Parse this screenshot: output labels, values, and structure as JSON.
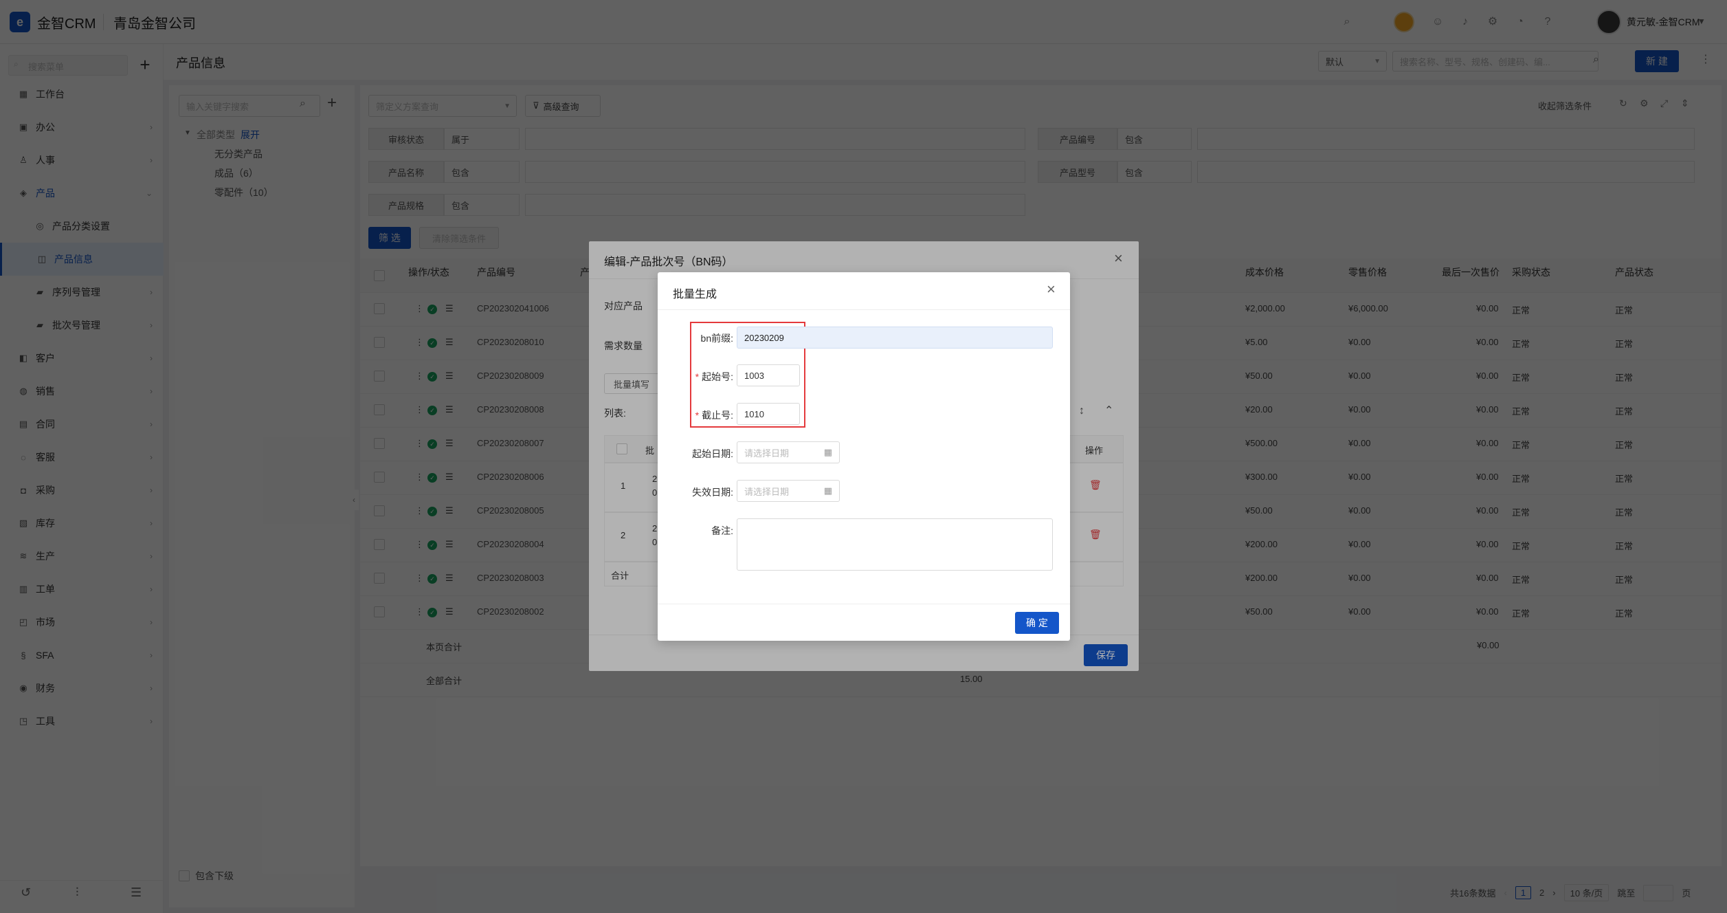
{
  "topbar": {
    "logo_letter": "e",
    "app_name": "金智CRM",
    "company": "青岛金智公司",
    "user_name": "黄元敏-金智CRM",
    "icons": [
      "search-icon",
      "orange-badge-icon",
      "contacts-icon",
      "bell-icon",
      "gear-icon",
      "pie-chart-icon",
      "help-icon"
    ]
  },
  "sidebar": {
    "search_placeholder": "搜索菜单",
    "items": [
      {
        "label": "工作台",
        "icon": "dashboard-icon",
        "has_arrow": false
      },
      {
        "label": "办公",
        "icon": "office-icon",
        "has_arrow": true
      },
      {
        "label": "人事",
        "icon": "people-icon",
        "has_arrow": true
      },
      {
        "label": "产品",
        "icon": "product-icon",
        "has_arrow": true,
        "expanded": true
      },
      {
        "label": "产品分类设置",
        "sub": true,
        "icon": "category-icon"
      },
      {
        "label": "产品信息",
        "sub": true,
        "active": true,
        "icon": "info-icon"
      },
      {
        "label": "序列号管理",
        "sub": true,
        "icon": "folder-icon",
        "has_arrow": true
      },
      {
        "label": "批次号管理",
        "sub": true,
        "icon": "folder-icon",
        "has_arrow": true
      },
      {
        "label": "客户",
        "icon": "customer-icon",
        "has_arrow": true
      },
      {
        "label": "销售",
        "icon": "sales-icon",
        "has_arrow": true
      },
      {
        "label": "合同",
        "icon": "contract-icon",
        "has_arrow": true
      },
      {
        "label": "客服",
        "icon": "service-icon",
        "has_arrow": true
      },
      {
        "label": "采购",
        "icon": "purchase-icon",
        "has_arrow": true
      },
      {
        "label": "库存",
        "icon": "inventory-icon",
        "has_arrow": true
      },
      {
        "label": "生产",
        "icon": "production-icon",
        "has_arrow": true
      },
      {
        "label": "工单",
        "icon": "ticket-icon",
        "has_arrow": true
      },
      {
        "label": "市场",
        "icon": "market-icon",
        "has_arrow": true
      },
      {
        "label": "SFA",
        "icon": "sfa-icon",
        "has_arrow": true
      },
      {
        "label": "财务",
        "icon": "finance-icon",
        "has_arrow": true
      },
      {
        "label": "工具",
        "icon": "tools-icon",
        "has_arrow": true
      }
    ]
  },
  "main": {
    "title": "产品信息",
    "view_select": "默认",
    "search_placeholder": "搜索名称、型号、规格、创建码、编...",
    "new_button": "新 建",
    "tree_search_placeholder": "输入关键字搜索",
    "tree": {
      "root": "全部类型",
      "expand": "展开",
      "children": [
        "无分类产品",
        "成品（6）",
        "零配件（10）"
      ],
      "include_sub": "包含下级"
    },
    "filter_scheme_placeholder": "筛定义方案查询",
    "advanced_query": "高级查询",
    "collapse_filter": "收起筛选条件",
    "filters": [
      {
        "label": "审核状态",
        "op": "属于"
      },
      {
        "label": "产品编号",
        "op": "包含"
      },
      {
        "label": "产品名称",
        "op": "包含"
      },
      {
        "label": "产品型号",
        "op": "包含"
      },
      {
        "label": "产品规格",
        "op": "包含"
      }
    ],
    "filter_button": "筛 选",
    "clear_button": "清除筛选条件",
    "columns": [
      "操作/状态",
      "产品编号",
      "产",
      "成本价格",
      "零售价格",
      "最后一次售价",
      "采购状态",
      "产品状态"
    ],
    "rows": [
      {
        "code": "CP202302041006",
        "cost": "¥2,000.00",
        "retail": "¥6,000.00",
        "last": "¥0.00",
        "purchase": "正常",
        "status": "正常"
      },
      {
        "code": "CP20230208010",
        "cost": "¥5.00",
        "retail": "¥0.00",
        "last": "¥0.00",
        "purchase": "正常",
        "status": "正常"
      },
      {
        "code": "CP20230208009",
        "cost": "¥50.00",
        "retail": "¥0.00",
        "last": "¥0.00",
        "purchase": "正常",
        "status": "正常"
      },
      {
        "code": "CP20230208008",
        "cost": "¥20.00",
        "retail": "¥0.00",
        "last": "¥0.00",
        "purchase": "正常",
        "status": "正常"
      },
      {
        "code": "CP20230208007",
        "cost": "¥500.00",
        "retail": "¥0.00",
        "last": "¥0.00",
        "purchase": "正常",
        "status": "正常"
      },
      {
        "code": "CP20230208006",
        "cost": "¥300.00",
        "retail": "¥0.00",
        "last": "¥0.00",
        "purchase": "正常",
        "status": "正常"
      },
      {
        "code": "CP20230208005",
        "cost": "¥50.00",
        "retail": "¥0.00",
        "last": "¥0.00",
        "purchase": "正常",
        "status": "正常"
      },
      {
        "code": "CP20230208004",
        "cost": "¥200.00",
        "retail": "¥0.00",
        "last": "¥0.00",
        "purchase": "正常",
        "status": "正常"
      },
      {
        "code": "CP20230208003",
        "cost": "¥200.00",
        "retail": "¥0.00",
        "last": "¥0.00",
        "purchase": "正常",
        "status": "正常"
      },
      {
        "code": "CP20230208002",
        "cost": "¥50.00",
        "retail": "¥0.00",
        "last": "¥0.00",
        "purchase": "正常",
        "status": "正常"
      }
    ],
    "page_total_label": "本页合计",
    "page_total_last": "¥0.00",
    "all_total_label": "全部合计",
    "all_total_value": "15.00",
    "pagination": {
      "total": "共16条数据",
      "pages": [
        "1",
        "2"
      ],
      "page_size": "10 条/页",
      "goto": "跳至",
      "page_unit": "页"
    }
  },
  "dialog_bn": {
    "title": "编辑-产品批次号（BN码）",
    "product_label": "对应产品",
    "qty_label": "需求数量",
    "batch_fill": "批量填写",
    "list_label": "列表:",
    "table_header_batch": "批",
    "table_header_op": "操作",
    "rows": [
      {
        "idx": "1",
        "v": "2",
        "v2": "0"
      },
      {
        "idx": "2",
        "v": "2",
        "v2": "0"
      }
    ],
    "total_label": "合计",
    "save_button": "保存"
  },
  "dialog_batch": {
    "title": "批量生成",
    "prefix_label": "bn前缀:",
    "prefix_value": "20230209",
    "start_label": "起始号:",
    "start_value": "1003",
    "end_label": "截止号:",
    "end_value": "1010",
    "start_date_label": "起始日期:",
    "start_date_placeholder": "请选择日期",
    "expire_date_label": "失效日期:",
    "expire_date_placeholder": "请选择日期",
    "remark_label": "备注:",
    "confirm_button": "确 定"
  }
}
